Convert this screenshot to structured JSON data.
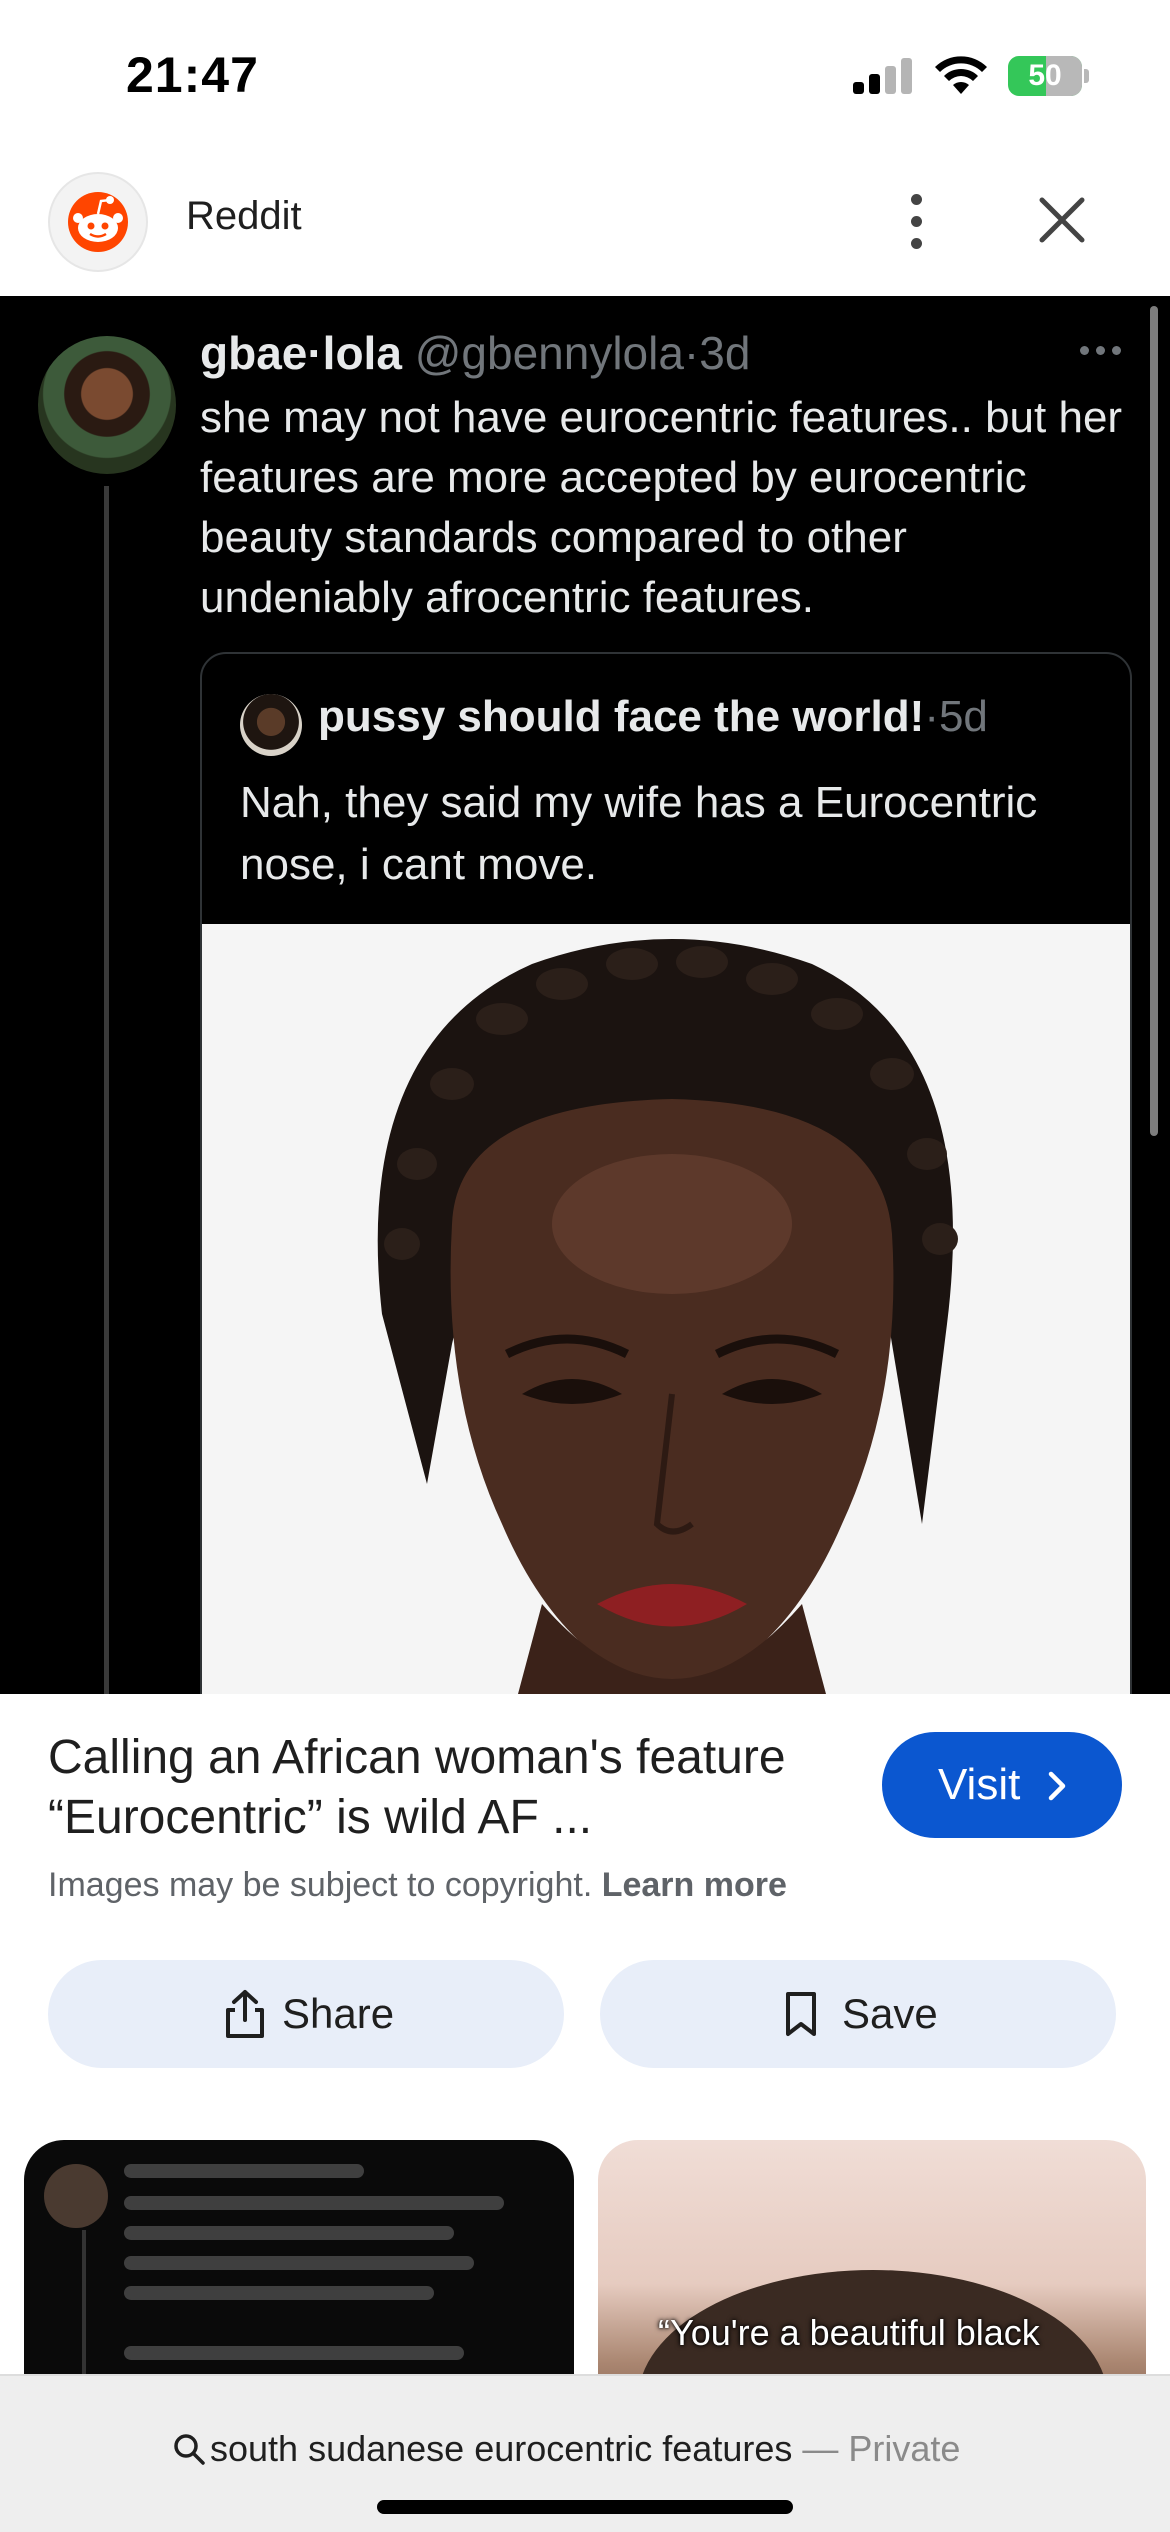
{
  "status_bar": {
    "time": "21:47",
    "battery_level": "50",
    "battery_percent": 50,
    "signal_bars": 2,
    "icons": [
      "signal-icon",
      "wifi-icon",
      "battery-charging-icon"
    ]
  },
  "header": {
    "site_name": "Reddit",
    "icons": [
      "reddit-logo-icon",
      "more-vert-icon",
      "close-icon"
    ]
  },
  "tweet": {
    "name": "gbae·lola",
    "handle_time": " @gbennylola·3d",
    "text": "she may not have eurocentric features.. but her features are more accepted by eurocentric beauty standards compared to other undeniably afrocentric features.",
    "quote": {
      "name": "pussy should face the world!",
      "time": "·5d",
      "text": "Nah, they said my wife has a Eurocentric nose, i cant move."
    }
  },
  "result": {
    "title": "Calling an African woman's feature “Eurocentric” is wild AF ...",
    "visit_label": "Visit",
    "copyright": "Images may be subject to copyright.",
    "learn_more": "Learn more",
    "share_label": "Share",
    "save_label": "Save"
  },
  "related": {
    "second_caption": "“You're a beautiful black"
  },
  "bottom_bar": {
    "query": "south sudanese eurocentric features",
    "private_label": " — Private"
  },
  "colors": {
    "accent": "#0b57d0",
    "action_button_bg": "#e8eef9",
    "battery_green": "#34c759",
    "reddit_orange": "#ff4500"
  }
}
